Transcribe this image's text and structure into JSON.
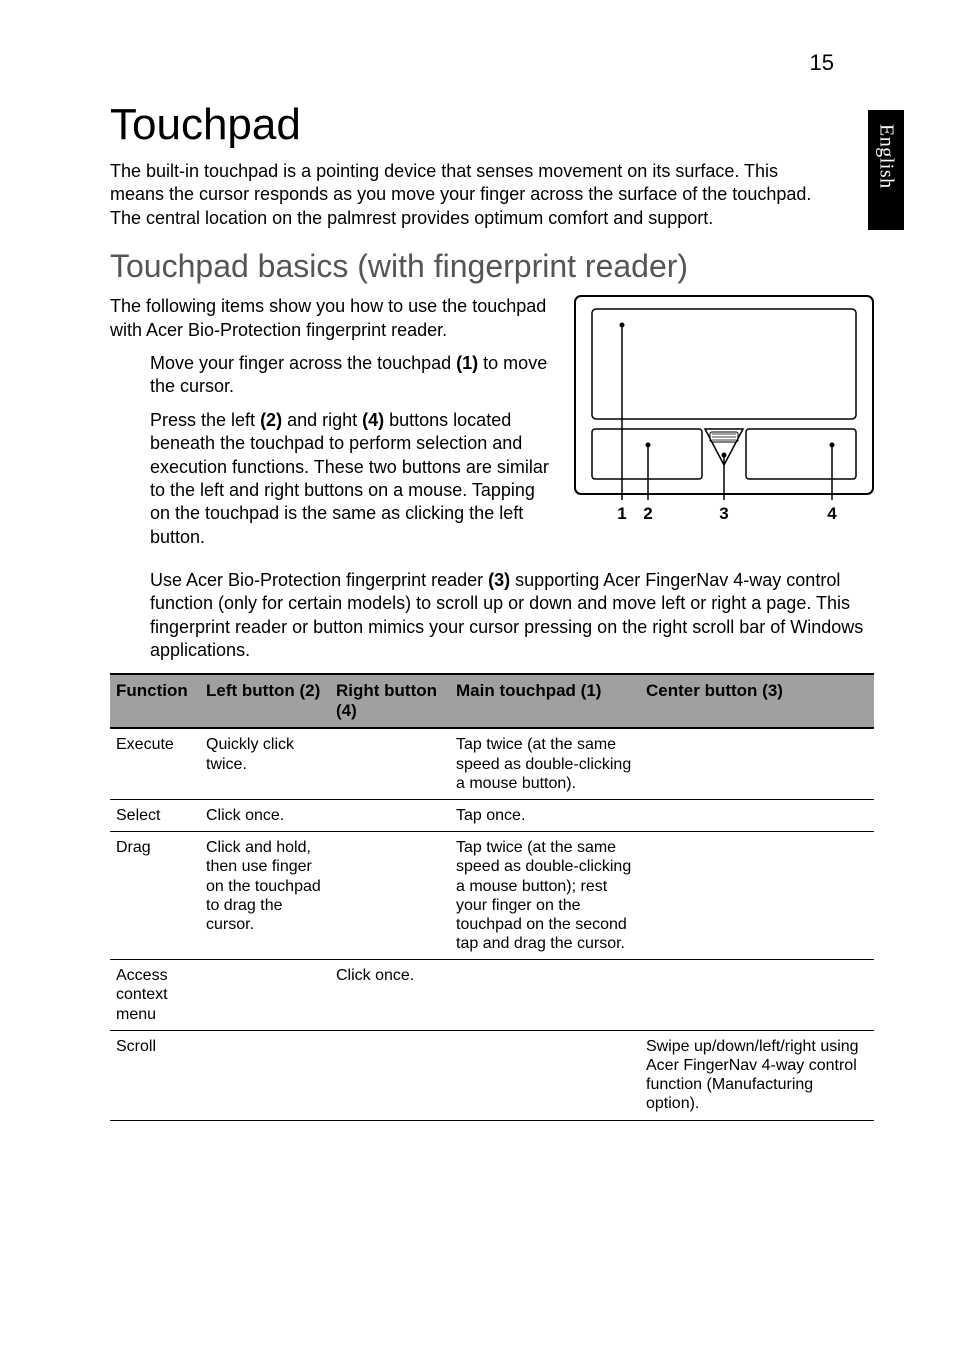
{
  "page": {
    "number": "15",
    "side_tab": "English"
  },
  "headings": {
    "h1": "Touchpad",
    "h2": "Touchpad basics (with fingerprint reader)"
  },
  "paragraphs": {
    "intro": "The built-in touchpad is a pointing device that senses movement on its surface. This means the cursor responds as you move your finger across the surface of the touchpad. The central location on the palmrest provides optimum comfort and support.",
    "following": "The following items show you how to use the touchpad with Acer Bio-Protection fingerprint reader."
  },
  "bullets": {
    "b1_pre": "Move your finger across the touchpad ",
    "b1_bold": "(1)",
    "b1_post": " to move the cursor.",
    "b2_pre": "Press the left ",
    "b2_bold1": "(2)",
    "b2_mid1": " and right ",
    "b2_bold2": "(4)",
    "b2_mid2": " buttons located beneath the touchpad to perform selection and execution functions. These two buttons are similar to the left and right buttons on a mouse. Tapping on the touchpad is the same as clicking the left button.",
    "b3_pre": "Use Acer Bio-Protection fingerprint reader ",
    "b3_bold": "(3)",
    "b3_post": " supporting Acer FingerNav 4-way control function (only for certain models) to scroll up or down and move left or right a page. This fingerprint reader or button mimics your cursor pressing on the right scroll bar of Windows applications."
  },
  "diagram": {
    "l1": "1",
    "l2": "2",
    "l3": "3",
    "l4": "4"
  },
  "table": {
    "headers": {
      "c1": "Function",
      "c2": "Left button (2)",
      "c3": "Right button (4)",
      "c4": "Main touchpad (1)",
      "c5": "Center button (3)"
    },
    "rows": [
      {
        "c1": "Execute",
        "c2": "Quickly click twice.",
        "c3": "",
        "c4": "Tap twice (at the same speed as double-clicking a mouse button).",
        "c5": ""
      },
      {
        "c1": "Select",
        "c2": "Click once.",
        "c3": "",
        "c4": "Tap once.",
        "c5": ""
      },
      {
        "c1": "Drag",
        "c2": "Click and hold, then use finger on the touchpad to drag the cursor.",
        "c3": "",
        "c4": "Tap twice (at the same speed as double-clicking a mouse button); rest your finger on the touchpad on the second tap and drag the cursor.",
        "c5": ""
      },
      {
        "c1": "Access context menu",
        "c2": "",
        "c3": "Click once.",
        "c4": "",
        "c5": ""
      },
      {
        "c1": "Scroll",
        "c2": "",
        "c3": "",
        "c4": "",
        "c5": "Swipe up/down/left/right using Acer FingerNav 4-way control function (Manufacturing option)."
      }
    ]
  }
}
